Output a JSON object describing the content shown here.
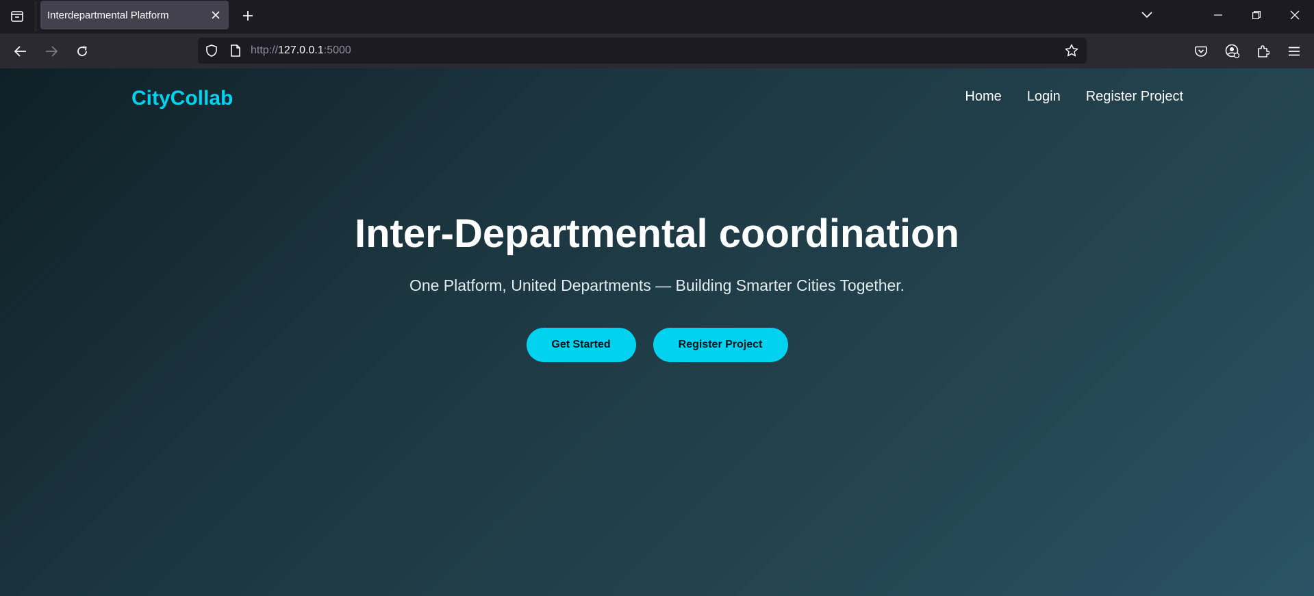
{
  "browser": {
    "tab_title": "Interdepartmental Platform",
    "url_prefix": "http://",
    "url_host": "127.0.0.1",
    "url_port": ":5000"
  },
  "site": {
    "logo": "CityCollab",
    "nav": {
      "home": "Home",
      "login": "Login",
      "register": "Register Project"
    }
  },
  "hero": {
    "title": "Inter-Departmental coordination",
    "subtitle": "One Platform, United Departments — Building Smarter Cities Together.",
    "primary_cta": "Get Started",
    "secondary_cta": "Register Project"
  },
  "colors": {
    "accent": "#00d2f0",
    "page_gradient_start": "#0f2027",
    "page_gradient_end": "#2a5364",
    "chrome_dark": "#1c1b22",
    "chrome_toolbar": "#2b2a33"
  },
  "icons": {
    "tab_list": "tab-list-icon",
    "tab_close": "close-icon",
    "new_tab": "plus-icon",
    "list_all_tabs": "chevron-down-icon",
    "minimize": "minimize-icon",
    "restore": "restore-icon",
    "close_window": "close-icon",
    "back": "arrow-left-icon",
    "forward": "arrow-right-icon",
    "reload": "reload-icon",
    "tracking_protection": "shield-icon",
    "page_info": "page-icon",
    "bookmark": "star-icon",
    "pocket": "pocket-icon",
    "account": "account-icon",
    "extensions": "puzzle-icon",
    "menu": "hamburger-icon"
  }
}
